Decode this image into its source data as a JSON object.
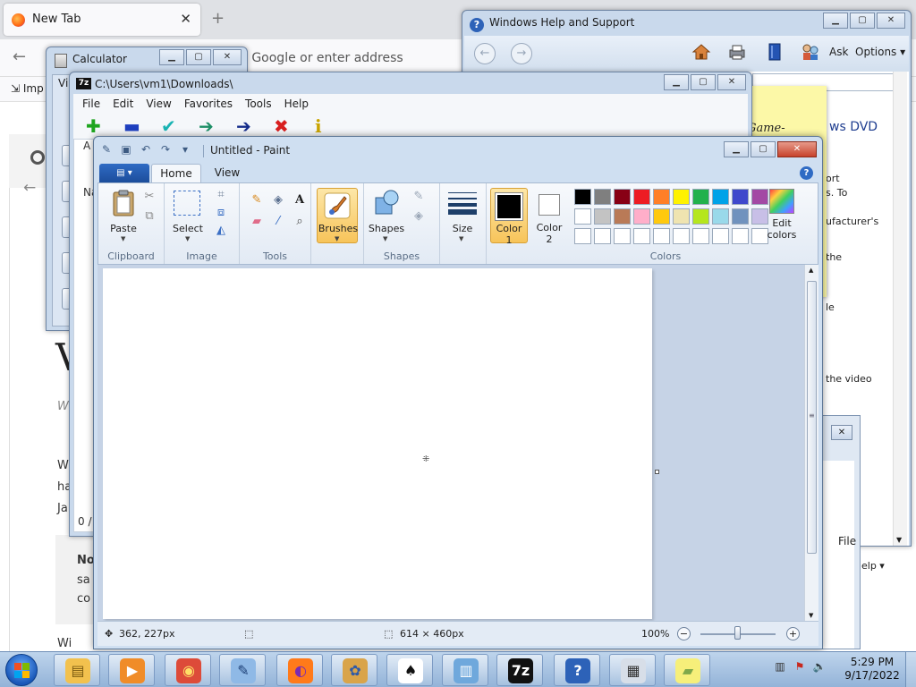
{
  "firefox": {
    "tab_title": "New Tab",
    "tab_close": "✕",
    "new_tab": "+",
    "back": "←",
    "url_placeholder": "h Google or enter address",
    "import_label": "Imp",
    "letter": "V",
    "frag_w1": "Wi",
    "frag_w2": "W",
    "frag_ha": "ha",
    "frag_ja": "Ja",
    "frag_no": "No",
    "frag_sa": "sa",
    "frag_co": "co",
    "frag_wi": "Wi"
  },
  "calculator": {
    "title": "Calculator",
    "frag_vi": "Vi"
  },
  "zip": {
    "icon": "7z",
    "title": "C:\\Users\\vm1\\Downloads\\",
    "menu": [
      "File",
      "Edit",
      "View",
      "Favorites",
      "Tools",
      "Help"
    ],
    "tools": [
      {
        "glyph": "✚",
        "color": "#1fa51f"
      },
      {
        "glyph": "▬",
        "color": "#1e3fbf"
      },
      {
        "glyph": "✔",
        "color": "#19b3b3"
      },
      {
        "glyph": "➔",
        "color": "#1d8f66"
      },
      {
        "glyph": "➔",
        "color": "#152c8a"
      },
      {
        "glyph": "✖",
        "color": "#d81f1f"
      },
      {
        "glyph": "i",
        "color": "#c9a400"
      }
    ],
    "frag_a": "A",
    "frag_na": "Na",
    "status_frag": "0 /"
  },
  "help": {
    "title": "Windows Help and Support",
    "back_arrow": "←",
    "fwd_arrow": "→",
    "ask": "Ask",
    "options": "Options",
    "heading_frag": "ws DVD",
    "t1": "ort",
    "t2": "s. To",
    "t3": "ufacturer's",
    "t4": "the",
    "t5": "le",
    "t6": "the video",
    "menu_frag": "elp ▾",
    "file_frag": "File"
  },
  "sticky": {
    "text": "Game-Game-Game-"
  },
  "paint": {
    "title": "Untitled - Paint",
    "tabs": [
      "Home",
      "View"
    ],
    "groups": {
      "clipboard": "Clipboard",
      "image": "Image",
      "tools": "Tools",
      "shapes": "Shapes",
      "colors": "Colors"
    },
    "buttons": {
      "paste": "Paste",
      "select": "Select",
      "brushes": "Brushes",
      "shapes": "Shapes",
      "size": "Size",
      "color1_a": "Color",
      "color1_b": "1",
      "color2_a": "Color",
      "color2_b": "2",
      "edit_a": "Edit",
      "edit_b": "colors"
    },
    "palette": [
      "#000000",
      "#7f7f7f",
      "#880015",
      "#ed1c24",
      "#ff7f27",
      "#fff200",
      "#22b14c",
      "#00a2e8",
      "#3f48cc",
      "#a349a4",
      "#ffffff",
      "#c3c3c3",
      "#b97a57",
      "#ffaec9",
      "#ffc90e",
      "#efe4b0",
      "#b5e61d",
      "#99d9ea",
      "#7092be",
      "#c8bfe7"
    ],
    "color1": "#000000",
    "color2": "#ffffff",
    "status": {
      "cursor_pos": "362, 227px",
      "canvas_size": "614 × 460px",
      "zoom": "100%"
    }
  },
  "taskbar": {
    "apps": [
      {
        "name": "explorer",
        "glyph": "▤",
        "bg": "#f2c14e",
        "fg": "#7a5a10"
      },
      {
        "name": "media-player",
        "glyph": "▶",
        "bg": "#f08c28",
        "fg": "#ffffff"
      },
      {
        "name": "chrome",
        "glyph": "◉",
        "bg": "#dd4b39",
        "fg": "#ffe066"
      },
      {
        "name": "tools",
        "glyph": "✎",
        "bg": "#8fb9e6",
        "fg": "#1c3f76"
      },
      {
        "name": "firefox",
        "glyph": "◐",
        "bg": "#ff7a1a",
        "fg": "#7b2bb0"
      },
      {
        "name": "paint",
        "glyph": "✿",
        "bg": "#d9a44a",
        "fg": "#2e5aa8"
      },
      {
        "name": "solitaire",
        "glyph": "♠",
        "bg": "#ffffff",
        "fg": "#111111"
      },
      {
        "name": "files",
        "glyph": "▥",
        "bg": "#6fa8dc",
        "fg": "#ffffff"
      },
      {
        "name": "7zip",
        "glyph": "7z",
        "bg": "#111111",
        "fg": "#ffffff"
      },
      {
        "name": "help",
        "glyph": "?",
        "bg": "#2d62b8",
        "fg": "#ffffff"
      },
      {
        "name": "calculator",
        "glyph": "▦",
        "bg": "#d7dee8",
        "fg": "#333333"
      },
      {
        "name": "sticky-notes",
        "glyph": "▰",
        "bg": "#f6ef7a",
        "fg": "#7fa84a"
      }
    ],
    "time": "5:29 PM",
    "date": "9/17/2022"
  }
}
